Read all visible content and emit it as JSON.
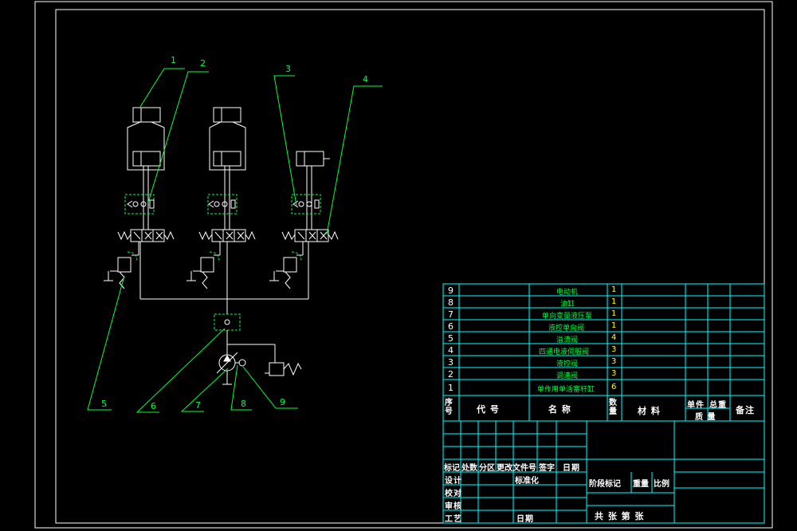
{
  "colors": {
    "background": "#000000",
    "frame": "#ffffff",
    "table_lines": "#00ffff",
    "schematic": "#ffffff",
    "dashed_boxes": "#00ff40",
    "item_names": "#00ff40",
    "quantities": "#ffff00",
    "callouts": "#00ff40"
  },
  "callouts": [
    "1",
    "2",
    "3",
    "4",
    "5",
    "6",
    "7",
    "8",
    "9"
  ],
  "bom": {
    "rows": [
      {
        "no": "9",
        "name": "电动机",
        "qty": "1"
      },
      {
        "no": "8",
        "name": "油缸",
        "qty": "1"
      },
      {
        "no": "7",
        "name": "单向变量液压泵",
        "qty": "1"
      },
      {
        "no": "6",
        "name": "液控单向阀",
        "qty": "1"
      },
      {
        "no": "5",
        "name": "溢流阀",
        "qty": "4"
      },
      {
        "no": "4",
        "name": "四通电液伺服阀",
        "qty": "3"
      },
      {
        "no": "3",
        "name": "液控阀",
        "qty": "3"
      },
      {
        "no": "2",
        "name": "调速阀",
        "qty": "3"
      },
      {
        "no": "1",
        "name": "单作用单活塞杆缸",
        "qty": "6"
      }
    ],
    "header": {
      "no": "序号",
      "code": "代  号",
      "name": "名  称",
      "qty": "数量",
      "material": "材  料",
      "unit_mass": "单件",
      "total_mass": "总重",
      "mass": "质 量",
      "remarks": "备注"
    }
  },
  "title_block": {
    "revision_header": [
      "标记",
      "处数",
      "分区",
      "更改文件号",
      "签字",
      "日期"
    ],
    "design": "设计",
    "standardization": "标准化",
    "check": "校对",
    "review": "审核",
    "process": "工艺",
    "date": "日期",
    "stage_mark": "阶段标记",
    "weight": "重量",
    "scale": "比例",
    "sheets": "共    张  第    张"
  }
}
